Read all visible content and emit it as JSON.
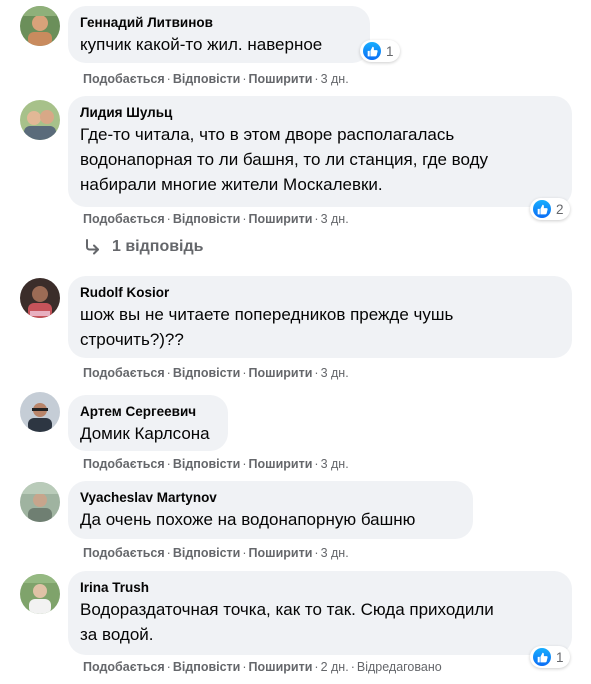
{
  "comments": [
    {
      "author": "Геннадий Литвинов",
      "text": [
        "купчик какой-то жил. наверное"
      ],
      "like": "Подобається",
      "reply": "Відповісти",
      "share": "Поширити",
      "time": "3 дн.",
      "edited": "",
      "reactions": "1"
    },
    {
      "author": "Лидия Шульц",
      "text": [
        "Где-то читала, что в этом дворе располагалась",
        "водонапорная то ли башня, то ли станция, где воду",
        "набирали многие жители Москалевки."
      ],
      "like": "Подобається",
      "reply": "Відповісти",
      "share": "Поширити",
      "time": "3 дн.",
      "edited": "",
      "reactions": "2"
    },
    {
      "author": "Rudolf Kosior",
      "text": [
        "шож вы не читаете попередников прежде чушь",
        "строчить?)??"
      ],
      "like": "Подобається",
      "reply": "Відповісти",
      "share": "Поширити",
      "time": "3 дн.",
      "edited": "",
      "reactions": ""
    },
    {
      "author": "Артем Сергеевич",
      "text": [
        "Домик Карлсона"
      ],
      "like": "Подобається",
      "reply": "Відповісти",
      "share": "Поширити",
      "time": "3 дн.",
      "edited": "",
      "reactions": ""
    },
    {
      "author": "Vyacheslav Martynov",
      "text": [
        "Да очень похоже на водонапорную башню"
      ],
      "like": "Подобається",
      "reply": "Відповісти",
      "share": "Поширити",
      "time": "3 дн.",
      "edited": "",
      "reactions": ""
    },
    {
      "author": "Irina Trush",
      "text": [
        "Водораздаточная точка, как то так. Сюда приходили",
        "за водой."
      ],
      "like": "Подобається",
      "reply": "Відповісти",
      "share": "Поширити",
      "time": "2 дн.",
      "edited": "Відредаговано",
      "reactions": "1"
    }
  ],
  "replies_link": "1 відповідь",
  "colors": {
    "bubble": "#f0f2f5",
    "secondary_text": "#65676b",
    "like_blue": "#1877f2"
  }
}
